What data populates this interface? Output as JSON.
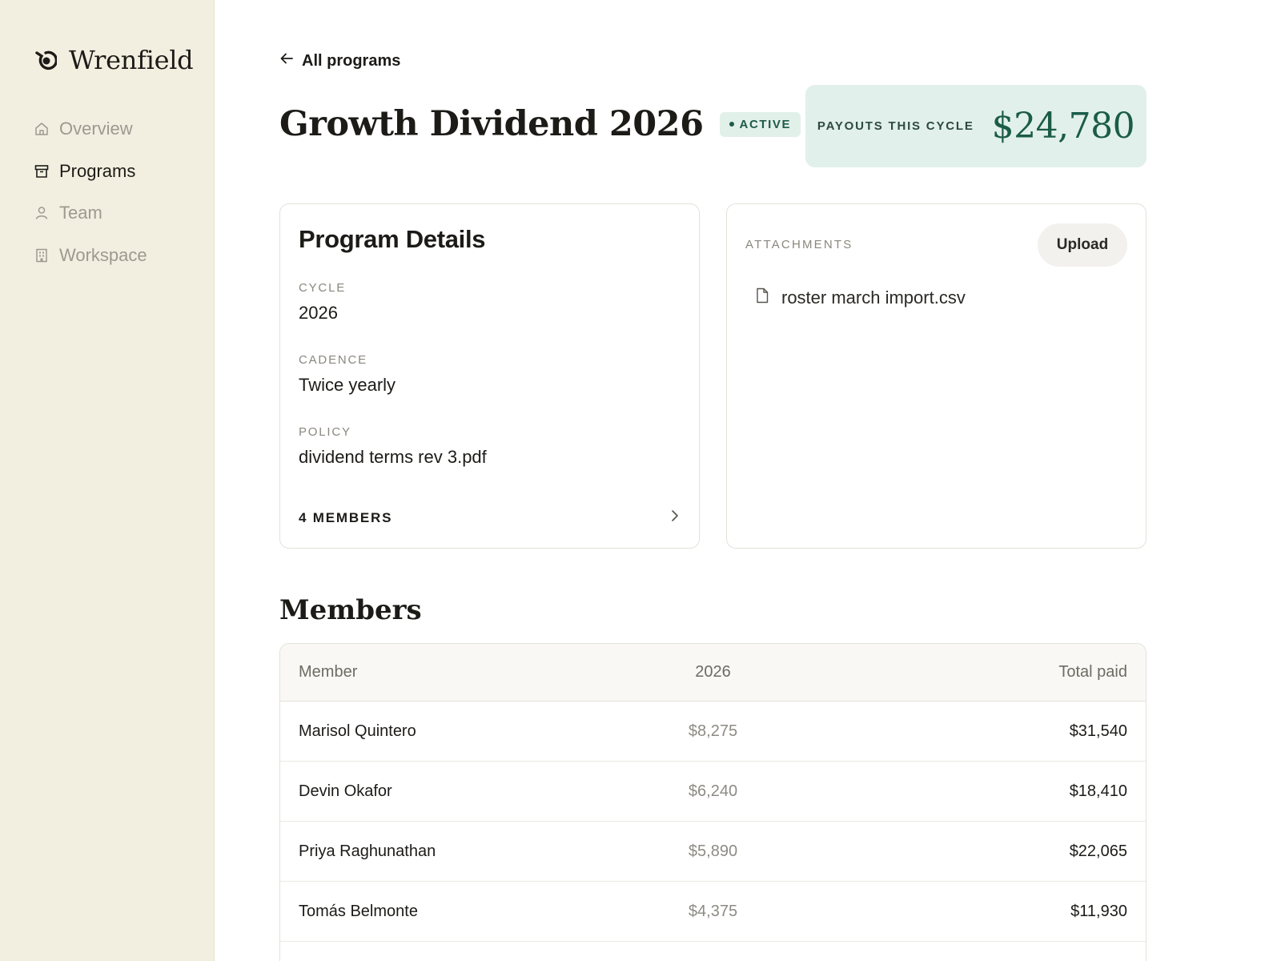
{
  "brand": {
    "name": "Wrenfield"
  },
  "nav": {
    "items": [
      {
        "label": "Overview",
        "icon": "home-icon",
        "active": false
      },
      {
        "label": "Programs",
        "icon": "archive-icon",
        "active": true
      },
      {
        "label": "Team",
        "icon": "person-icon",
        "active": false
      },
      {
        "label": "Workspace",
        "icon": "building-icon",
        "active": false
      }
    ]
  },
  "header": {
    "back_label": "All programs",
    "title": "Growth Dividend 2026",
    "status": "ACTIVE",
    "payout_label": "PAYOUTS THIS CYCLE",
    "payout_value": "$24,780"
  },
  "details": {
    "title": "Program Details",
    "fields": [
      {
        "label": "CYCLE",
        "value": "2026"
      },
      {
        "label": "CADENCE",
        "value": "Twice yearly"
      },
      {
        "label": "POLICY",
        "value": "dividend terms rev 3.pdf"
      }
    ],
    "members_link": "4 MEMBERS"
  },
  "attachments": {
    "label": "ATTACHMENTS",
    "upload_label": "Upload",
    "files": [
      {
        "name": "roster march import.csv",
        "icon": "file-icon"
      }
    ]
  },
  "members": {
    "title": "Members",
    "columns": [
      "Member",
      "2026",
      "Total paid"
    ],
    "rows": [
      {
        "name": "Marisol Quintero",
        "year": "$8,275",
        "total": "$31,540"
      },
      {
        "name": "Devin Okafor",
        "year": "$6,240",
        "total": "$18,410"
      },
      {
        "name": "Priya Raghunathan",
        "year": "$5,890",
        "total": "$22,065"
      },
      {
        "name": "Tomás Belmonte",
        "year": "$4,375",
        "total": "$11,930"
      }
    ]
  },
  "colors": {
    "sidebar_bg": "#f3efe0",
    "accent_green": "#1b5c48",
    "badge_bg": "#e2f0ea"
  }
}
